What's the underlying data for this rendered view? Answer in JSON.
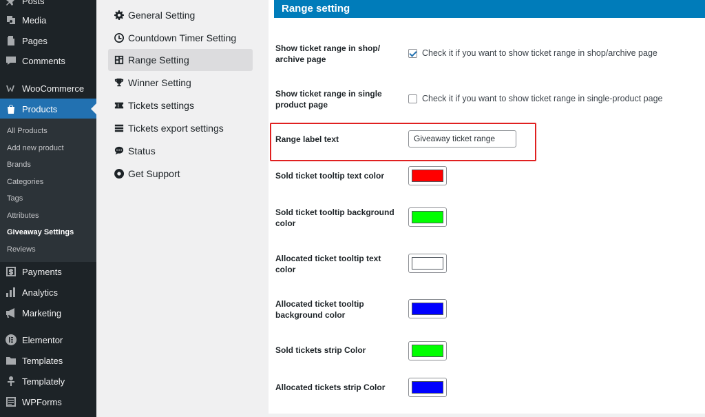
{
  "sidebar": {
    "items": [
      {
        "label": "Posts",
        "icon": "pin-icon"
      },
      {
        "label": "Media",
        "icon": "media-icon"
      },
      {
        "label": "Pages",
        "icon": "pages-icon"
      },
      {
        "label": "Comments",
        "icon": "comments-icon"
      },
      {
        "label": "WooCommerce",
        "icon": "woocommerce-icon"
      },
      {
        "label": "Products",
        "icon": "products-icon",
        "current": true
      },
      {
        "label": "Payments",
        "icon": "payments-icon"
      },
      {
        "label": "Analytics",
        "icon": "analytics-icon"
      },
      {
        "label": "Marketing",
        "icon": "megaphone-icon"
      },
      {
        "label": "Elementor",
        "icon": "elementor-icon"
      },
      {
        "label": "Templates",
        "icon": "folder-icon"
      },
      {
        "label": "Templately",
        "icon": "templately-icon"
      },
      {
        "label": "WPForms",
        "icon": "wpforms-icon"
      }
    ],
    "submenu": [
      {
        "label": "All Products"
      },
      {
        "label": "Add new product"
      },
      {
        "label": "Brands"
      },
      {
        "label": "Categories"
      },
      {
        "label": "Tags"
      },
      {
        "label": "Attributes"
      },
      {
        "label": "Giveaway Settings",
        "active": true
      },
      {
        "label": "Reviews"
      }
    ]
  },
  "tabs": [
    {
      "label": "General Setting",
      "icon": "gear-icon"
    },
    {
      "label": "Countdown Timer Setting",
      "icon": "clock-icon"
    },
    {
      "label": "Range Setting",
      "icon": "range-icon",
      "active": true
    },
    {
      "label": "Winner Setting",
      "icon": "trophy-icon"
    },
    {
      "label": "Tickets settings",
      "icon": "tickets-icon"
    },
    {
      "label": "Tickets export settings",
      "icon": "export-icon"
    },
    {
      "label": "Status",
      "icon": "speech-bubble-icon"
    },
    {
      "label": "Get Support",
      "icon": "lifebuoy-icon"
    }
  ],
  "panel": {
    "title": "Range setting",
    "shop_range": {
      "label": "Show ticket range in shop/ archive page",
      "checkbox_text": "Check it if you want to show ticket range in shop/archive page",
      "checked": true
    },
    "single_range": {
      "label": "Show ticket range in single product page",
      "checkbox_text": "Check it if you want to show ticket range in single-product page",
      "checked": false
    },
    "range_label": {
      "label": "Range label text",
      "value": "Giveaway ticket range"
    },
    "colors": [
      {
        "label": "Sold ticket tooltip text color",
        "value": "#ff0000"
      },
      {
        "label": "Sold ticket tooltip background color",
        "value": "#00ff00"
      },
      {
        "label": "Allocated ticket tooltip text color",
        "value": "#ffffff"
      },
      {
        "label": "Allocated ticket tooltip background color",
        "value": "#0000ff"
      },
      {
        "label": "Sold tickets strip Color",
        "value": "#00ff00"
      },
      {
        "label": "Allocated tickets strip Color",
        "value": "#0000ff"
      }
    ]
  }
}
